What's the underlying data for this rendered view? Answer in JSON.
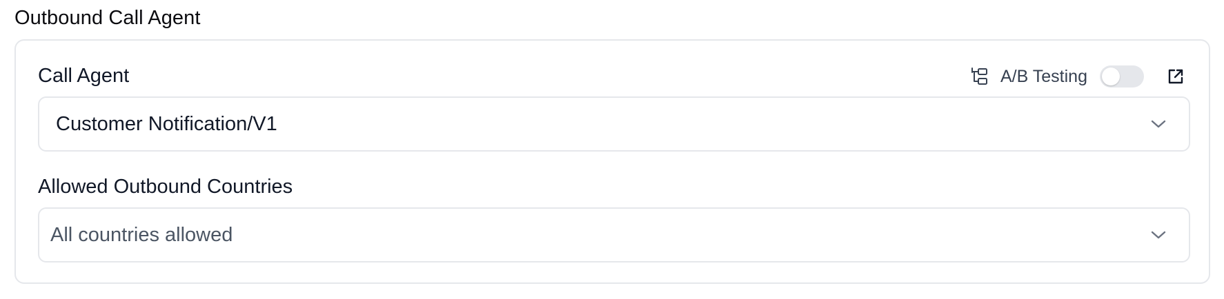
{
  "section": {
    "title": "Outbound Call Agent"
  },
  "call_agent": {
    "label": "Call Agent",
    "ab_testing_label": "A/B Testing",
    "ab_testing_enabled": false,
    "selected_value": "Customer Notification/V1"
  },
  "allowed_countries": {
    "label": "Allowed Outbound Countries",
    "placeholder": "All countries allowed"
  },
  "icons": {
    "ab_testing": "branch-icon",
    "open_external": "external-link-icon",
    "dropdown": "chevron-down-icon"
  },
  "colors": {
    "border": "#e5e7eb",
    "toggle_off": "#e5e7eb",
    "text": "#111827",
    "muted_text": "#4b5563"
  }
}
